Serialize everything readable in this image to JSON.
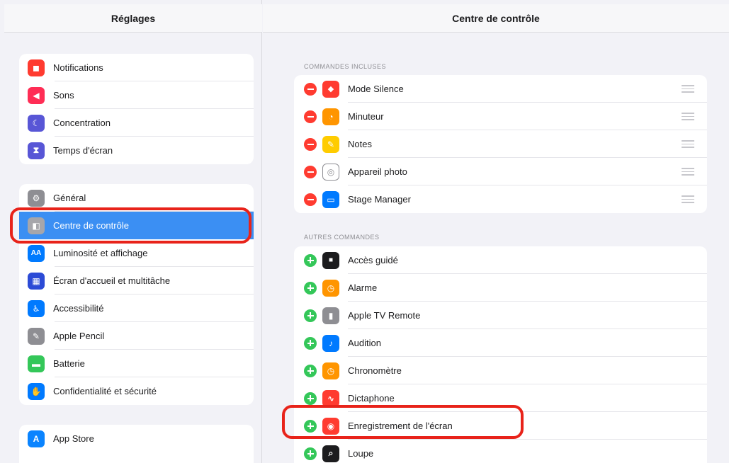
{
  "sidebar": {
    "title": "Réglages",
    "group1": [
      {
        "label": "Notifications",
        "color": "#ff3b30",
        "glyph": "◼"
      },
      {
        "label": "Sons",
        "color": "#ff2d55",
        "glyph": "◀"
      },
      {
        "label": "Concentration",
        "color": "#5856d6",
        "glyph": "☾"
      },
      {
        "label": "Temps d'écran",
        "color": "#5856d6",
        "glyph": "⧗"
      }
    ],
    "group2": [
      {
        "label": "Général",
        "color": "#8e8e93",
        "glyph": "⚙"
      },
      {
        "label": "Centre de contrôle",
        "color": "#8e8e93",
        "glyph": "◧"
      },
      {
        "label": "Luminosité et affichage",
        "color": "#007aff",
        "glyph": "AA"
      },
      {
        "label": "Écran d'accueil et multitâche",
        "color": "#2c4bd6",
        "glyph": "▦"
      },
      {
        "label": "Accessibilité",
        "color": "#007aff",
        "glyph": "♿"
      },
      {
        "label": "Apple Pencil",
        "color": "#8e8e93",
        "glyph": "✎"
      },
      {
        "label": "Batterie",
        "color": "#34c759",
        "glyph": "▬"
      },
      {
        "label": "Confidentialité et sécurité",
        "color": "#007aff",
        "glyph": "✋"
      }
    ],
    "group3": [
      {
        "label": "App Store",
        "color": "#0a84ff",
        "glyph": "A"
      }
    ]
  },
  "detail": {
    "title": "Centre de contrôle",
    "included_header": "COMMANDES INCLUSES",
    "included": [
      {
        "label": "Mode Silence",
        "color": "#ff3b30",
        "glyph": "🔔"
      },
      {
        "label": "Minuteur",
        "color": "#ff9500",
        "glyph": "◔"
      },
      {
        "label": "Notes",
        "color": "#ffcc00",
        "glyph": "✎"
      },
      {
        "label": "Appareil photo",
        "color": "#8e8e93",
        "glyph": "◎"
      },
      {
        "label": "Stage Manager",
        "color": "#007aff",
        "glyph": "▭"
      }
    ],
    "more_header": "AUTRES COMMANDES",
    "more": [
      {
        "label": "Accès guidé",
        "color": "#1c1c1e",
        "glyph": "🔒"
      },
      {
        "label": "Alarme",
        "color": "#ff9500",
        "glyph": "⏰"
      },
      {
        "label": "Apple TV Remote",
        "color": "#8e8e93",
        "glyph": "▮"
      },
      {
        "label": "Audition",
        "color": "#007aff",
        "glyph": "♪"
      },
      {
        "label": "Chronomètre",
        "color": "#ff9500",
        "glyph": "◷"
      },
      {
        "label": "Dictaphone",
        "color": "#ff3b30",
        "glyph": "∿"
      },
      {
        "label": "Enregistrement de l'écran",
        "color": "#ff3b30",
        "glyph": "◉"
      },
      {
        "label": "Loupe",
        "color": "#1c1c1e",
        "glyph": "⌕"
      }
    ]
  },
  "highlight_color": "#e8231a"
}
